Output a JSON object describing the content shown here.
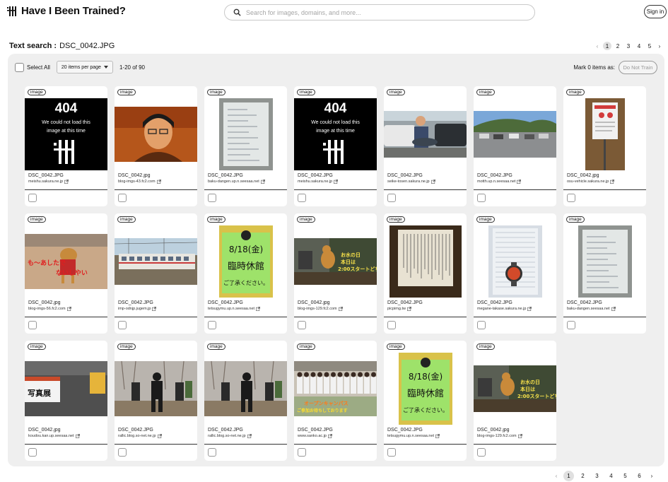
{
  "app": {
    "title": "Have I Been Trained?",
    "search_placeholder": "Search for images, domains, and more...",
    "signin_label": "Sign in"
  },
  "query": {
    "label": "Text search :",
    "value": "DSC_0042.JPG"
  },
  "pagination_top": {
    "pages": [
      "1",
      "2",
      "3",
      "4",
      "5"
    ],
    "active": "1",
    "prev": "‹",
    "next": "›"
  },
  "pagination_bottom": {
    "pages": [
      "1",
      "2",
      "3",
      "4",
      "5",
      "6"
    ],
    "active": "1",
    "prev": "‹",
    "next": "›"
  },
  "toolbar": {
    "select_all": "Select All",
    "per_page": "20 items per page",
    "range": "1-20 of 90",
    "mark_label": "Mark 0 items as:",
    "do_not_train": "Do Not Train"
  },
  "error_thumb": {
    "code": "404",
    "message_line1": "We could not load this",
    "message_line2": "image at this time"
  },
  "badge_label": "image",
  "results": [
    {
      "filename": "DSC_0042.JPG",
      "domain": "meishu.sakura.ne.jp",
      "thumb": "error"
    },
    {
      "filename": "DSC_0042.jpg",
      "domain": "blog-imgs-43.fc2.com",
      "thumb": "portrait"
    },
    {
      "filename": "DSC_0042.JPG",
      "domain": "baku-dangen.up.n.seesaa.net",
      "thumb": "whiteboard"
    },
    {
      "filename": "DSC_0042.JPG",
      "domain": "meishu.sakura.ne.jp",
      "thumb": "error"
    },
    {
      "filename": "DSC_0042.JPG",
      "domain": "seike-tosen.sakura.ne.jp",
      "thumb": "fish"
    },
    {
      "filename": "DSC_0042.JPG",
      "domain": "motth.up.n.seesaa.net",
      "thumb": "parking"
    },
    {
      "filename": "DSC_0042.jpg",
      "domain": "osu-vehicle.sakura.ne.jp",
      "thumb": "signboard"
    },
    {
      "filename": "DSC_0042.jpg",
      "domain": "blog-imgs-56.fc2.com",
      "thumb": "dog-red"
    },
    {
      "filename": "DSC_0042.JPG",
      "domain": "imp-odnjp.jugem.jp",
      "thumb": "train"
    },
    {
      "filename": "DSC_0042.JPG",
      "domain": "tetsugymu.up.n.seesaa.net",
      "thumb": "notice-green"
    },
    {
      "filename": "DSC_0042.jpg",
      "domain": "blog-imgs-129.fc2.com",
      "thumb": "dog-photo"
    },
    {
      "filename": "DSC_0042.JPG",
      "domain": "picpimg.tw",
      "thumb": "document"
    },
    {
      "filename": "DSC_0042.JPG",
      "domain": "megane-takase.sakura.ne.jp",
      "thumb": "watch"
    },
    {
      "filename": "DSC_0042.JPG",
      "domain": "baku-dangen.seesaa.net",
      "thumb": "whiteboard2"
    },
    {
      "filename": "DSC_0042.jpg",
      "domain": "koudou.kan.up.seesaa.net",
      "thumb": "exhibit"
    },
    {
      "filename": "DSC_0042.JPG",
      "domain": "rallic.blog.so-net.ne.jp",
      "thumb": "baseball"
    },
    {
      "filename": "DSC_0042.JPG",
      "domain": "rallic.blog.so-net.ne.jp",
      "thumb": "baseball"
    },
    {
      "filename": "DSC_0042.JPG",
      "domain": "www.sanko.ac.jp",
      "thumb": "group"
    },
    {
      "filename": "DSC_0042.JPG",
      "domain": "tetsugymu.up.n.seesaa.net",
      "thumb": "notice-green"
    },
    {
      "filename": "DSC_0042.jpg",
      "domain": "blog-imgs-129.fc2.com",
      "thumb": "dog-photo"
    }
  ],
  "thumb_text": {
    "dog-red": "も～あしたで ないしやい",
    "notice-green": "8/18(金) 臨時休館 ご了承ください。",
    "dog-photo": "お水の日 本日は 2:00スタートどち",
    "exhibit": "写真展",
    "group": "オープンキャンパス ご参加お待ちしております"
  }
}
